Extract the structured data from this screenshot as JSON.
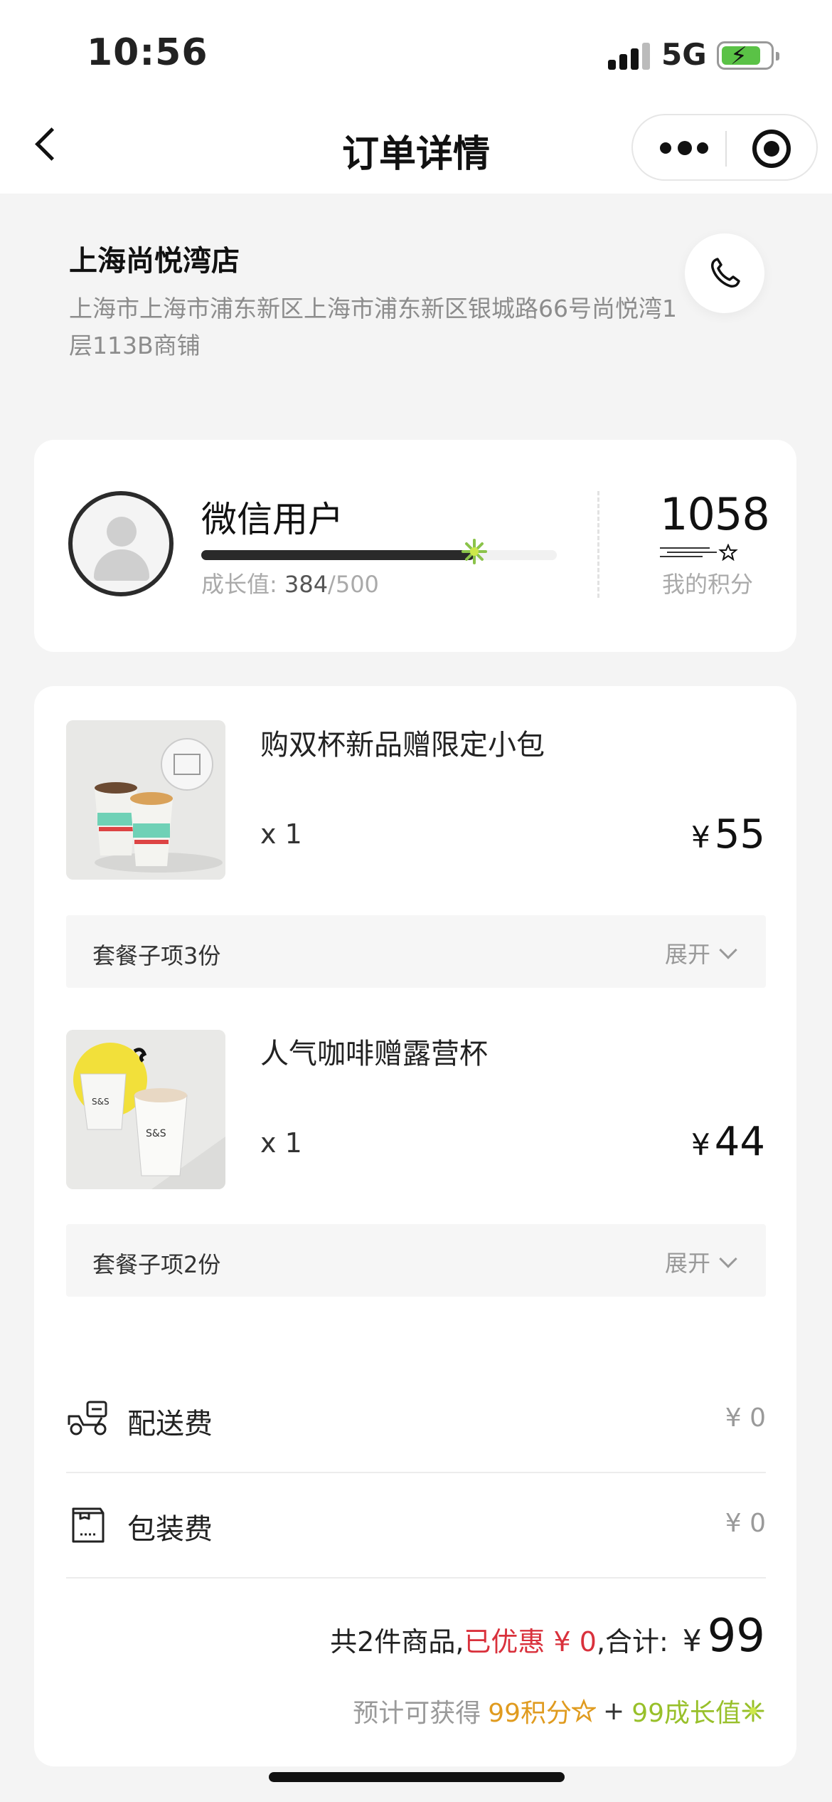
{
  "status_bar": {
    "time": "10:56",
    "network": "5G"
  },
  "nav": {
    "title": "订单详情"
  },
  "store": {
    "name": "上海尚悦湾店",
    "address": "上海市上海市浦东新区上海市浦东新区银城路66号尚悦湾1层113B商铺"
  },
  "member": {
    "name": "微信用户",
    "growth_label": "成长值:",
    "growth_value": "384",
    "growth_max": "/500",
    "growth_progress": 0.768,
    "points": "1058",
    "points_label": "我的积分"
  },
  "products": [
    {
      "name": "购双杯新品赠限定小包",
      "qty": "x 1",
      "currency": "¥",
      "price": "55",
      "combo": "套餐子项3份",
      "expand": "展开"
    },
    {
      "name": "人气咖啡赠露营杯",
      "qty": "x 1",
      "currency": "¥",
      "price": "44",
      "combo": "套餐子项2份",
      "expand": "展开"
    }
  ],
  "fees": [
    {
      "label": "配送费",
      "amount": "¥ 0",
      "icon": "delivery-scooter-icon"
    },
    {
      "label": "包装费",
      "amount": "¥ 0",
      "icon": "package-bag-icon"
    }
  ],
  "summary": {
    "count_text": "共2件商品,",
    "discount_text": "已优惠 ¥ 0",
    "total_label": ",合计:",
    "currency": "¥",
    "total": "99"
  },
  "reward": {
    "prefix": "预计可获得",
    "points_text": "99积分",
    "plus": "+",
    "growth_text": "99成长值"
  },
  "colors": {
    "discount": "#d9313c",
    "points": "#e09b1f",
    "growth": "#98c02a",
    "progress": "#2a2a2a"
  }
}
